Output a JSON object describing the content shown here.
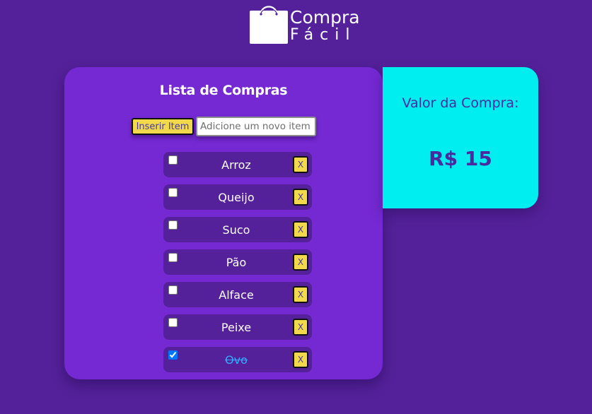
{
  "logo": {
    "line1": "Compra",
    "line2": "Fácil"
  },
  "list": {
    "title": "Lista de Compras",
    "add_button_label": "Inserir Item",
    "input_placeholder": "Adicione um novo item",
    "input_value": "",
    "remove_label": "X",
    "items": [
      {
        "label": "Arroz",
        "checked": false
      },
      {
        "label": "Queijo",
        "checked": false
      },
      {
        "label": "Suco",
        "checked": false
      },
      {
        "label": "Pão",
        "checked": false
      },
      {
        "label": "Alface",
        "checked": false
      },
      {
        "label": "Peixe",
        "checked": false
      },
      {
        "label": "Ovo",
        "checked": true
      }
    ]
  },
  "summary": {
    "title": "Valor da Compra:",
    "amount": "R$ 15"
  },
  "colors": {
    "background": "#54219a",
    "card": "#7429d3",
    "summary_card": "#00eef0",
    "accent_button": "#f2d94b",
    "done_text": "#35a9ff"
  },
  "icons": {
    "logo": "shopping-bag-icon"
  }
}
